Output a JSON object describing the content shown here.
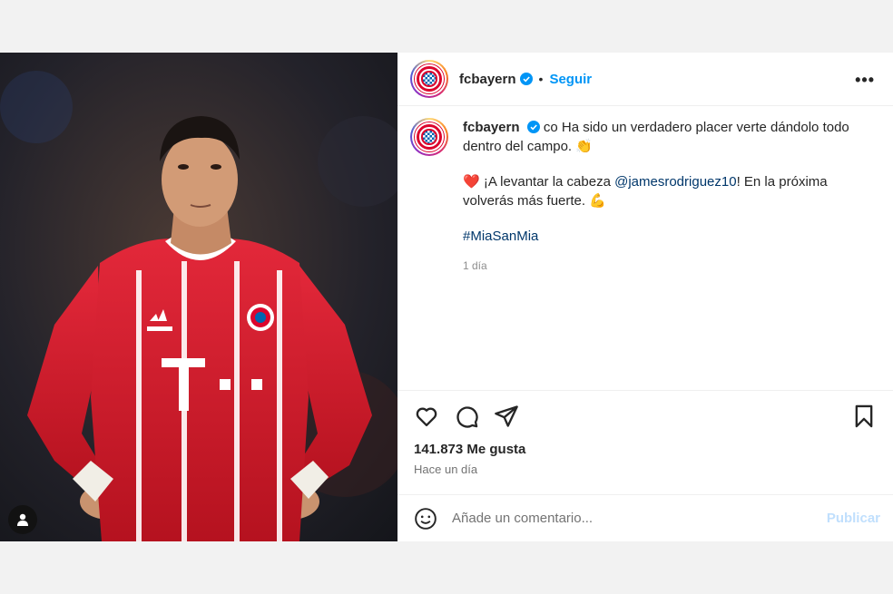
{
  "header": {
    "username": "fcbayern",
    "separator": "•",
    "follow_label": "Seguir",
    "more_label": "•••"
  },
  "caption": {
    "username": "fcbayern",
    "line1": "co Ha sido un verdadero placer verte dándolo todo dentro del campo. 👏",
    "line2_prefix": "❤️ ¡A levantar la cabeza ",
    "mention": "@jamesrodriguez10",
    "line2_suffix": "! En la próxima volverás más fuerte. 💪",
    "hashtag": "#MiaSanMia",
    "age": "1 día"
  },
  "stats": {
    "likes": "141.873 Me gusta",
    "posted": "Hace un día"
  },
  "comment": {
    "placeholder": "Añade un comentario...",
    "publish_label": "Publicar"
  },
  "colors": {
    "accent": "#0095f6",
    "link": "#00376b",
    "bayern_red": "#dc052d",
    "jersey_red": "#d8202c"
  },
  "icons": [
    "user-tag-icon",
    "verified-icon",
    "more-icon",
    "heart-icon",
    "comment-icon",
    "share-icon",
    "bookmark-icon",
    "emoji-icon"
  ]
}
